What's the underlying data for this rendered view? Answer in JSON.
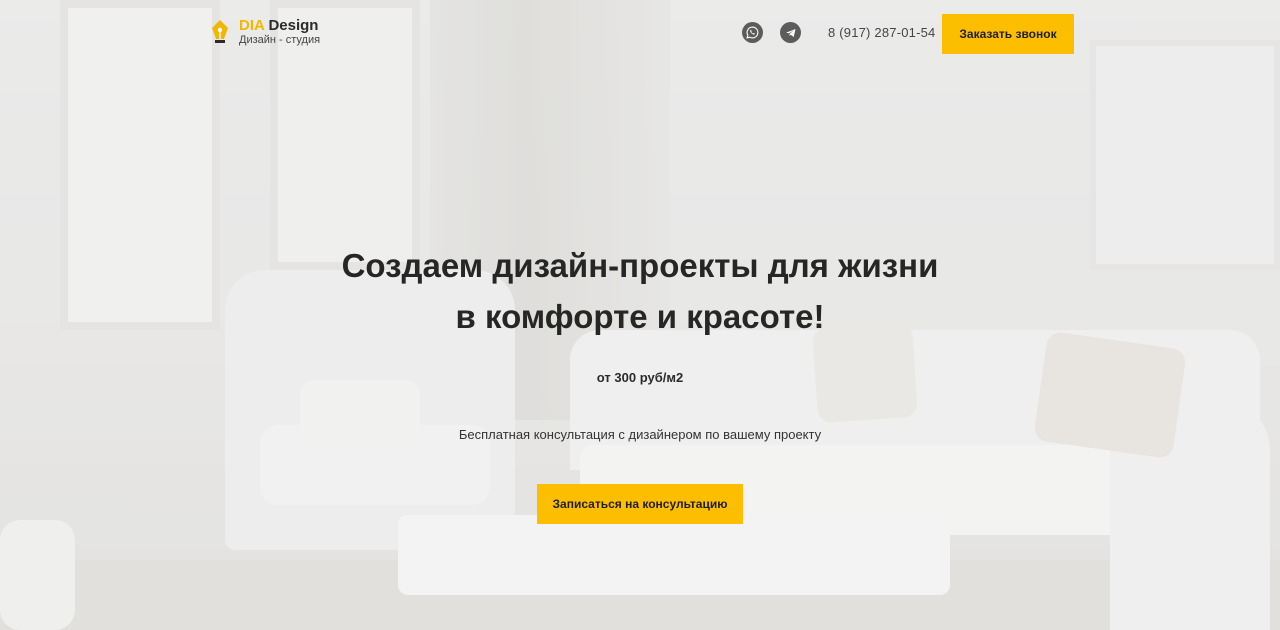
{
  "header": {
    "logo": {
      "brand_accent": "DIA",
      "brand_rest": " Design",
      "subtitle": "Дизайн - студия"
    },
    "whatsapp_icon": "whatsapp-icon",
    "telegram_icon": "telegram-icon",
    "phone": "8 (917) 287-01-54",
    "call_button": "Заказать звонок"
  },
  "hero": {
    "headline_line1": "Создаем дизайн-проекты для жизни",
    "headline_line2": "в комфорте и красоте!",
    "price": "от 300 руб/м2",
    "subtitle": "Бесплатная консультация с дизайнером по вашему проекту",
    "cta_button": "Записаться на консультацию"
  },
  "colors": {
    "accent": "#fdbe00",
    "logo_accent": "#f2b705",
    "icon_gray": "#5c5c5c",
    "text_dark": "#262626"
  }
}
